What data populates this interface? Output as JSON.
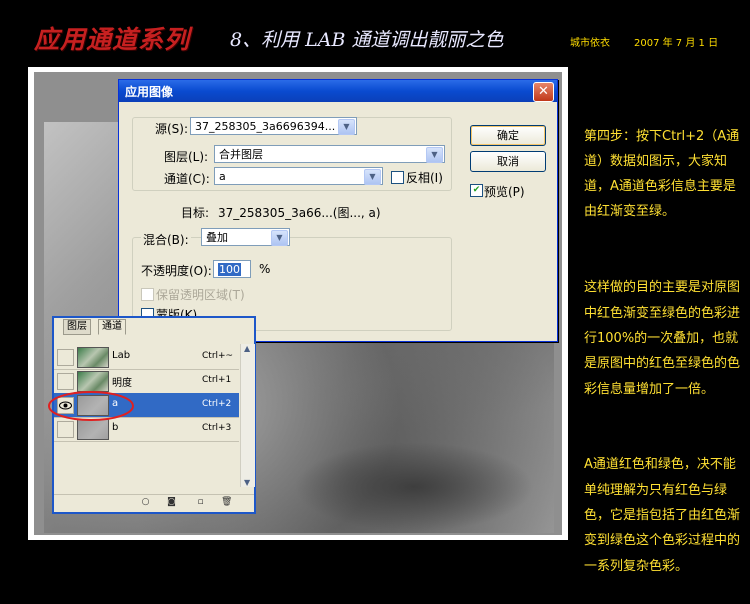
{
  "header": {
    "series": "应用通道系列",
    "lesson": "8、利用 LAB 通道调出靓丽之色",
    "author": "城市依衣",
    "date": "2007 年 7 月 1 日"
  },
  "dialog": {
    "title": "应用图像",
    "close_glyph": "✕",
    "source_label": "源(S):",
    "source_value": "37_258305_3a6696394...",
    "layer_label": "图层(L):",
    "layer_value": "合并图层",
    "channel_label": "通道(C):",
    "channel_value": "a",
    "invert_label": "反相(I)",
    "target_label": "目标:",
    "target_value": "37_258305_3a66...(图..., a)",
    "blend_label": "混合(B):",
    "blend_value": "叠加",
    "opacity_label": "不透明度(O):",
    "opacity_value": "100",
    "opacity_unit": "%",
    "preserve_label": "保留透明区域(T)",
    "mask_label": "蒙版(K)...",
    "ok_label": "确定",
    "cancel_label": "取消",
    "preview_label": "预览(P)",
    "preview_checked": true
  },
  "palette": {
    "tabs": [
      "图层",
      "通道"
    ],
    "channels": [
      {
        "name": "Lab",
        "shortcut": "Ctrl+~",
        "visible": false,
        "selected": false,
        "thumb": "color"
      },
      {
        "name": "明度",
        "shortcut": "Ctrl+1",
        "visible": false,
        "selected": false,
        "thumb": "color"
      },
      {
        "name": "a",
        "shortcut": "Ctrl+2",
        "visible": true,
        "selected": true,
        "thumb": "gray"
      },
      {
        "name": "b",
        "shortcut": "Ctrl+3",
        "visible": false,
        "selected": false,
        "thumb": "gray"
      }
    ],
    "bottom_icons": [
      "load-selection-icon",
      "save-selection-icon",
      "new-channel-icon",
      "delete-channel-icon"
    ]
  },
  "notes": {
    "paragraphs": [
      "第四步：按下Ctrl+2（A通道）数据如图示，大家知道，A通道色彩信息主要是由红渐变至绿。",
      "这样做的目的主要是对原图中红色渐变至绿色的色彩进行100%的一次叠加，也就是原图中的红色至绿色的色彩信息量增加了一倍。",
      "A通道红色和绿色，决不能单纯理解为只有红色与绿色，它是指包括了由红色渐变到绿色这个色彩过程中的一系列复杂色彩。"
    ]
  },
  "colors": {
    "accent_title": "#c62020",
    "note_text": "#ffe033",
    "xp_title_bar": "#0a4bd0",
    "selection": "#316ac5"
  }
}
